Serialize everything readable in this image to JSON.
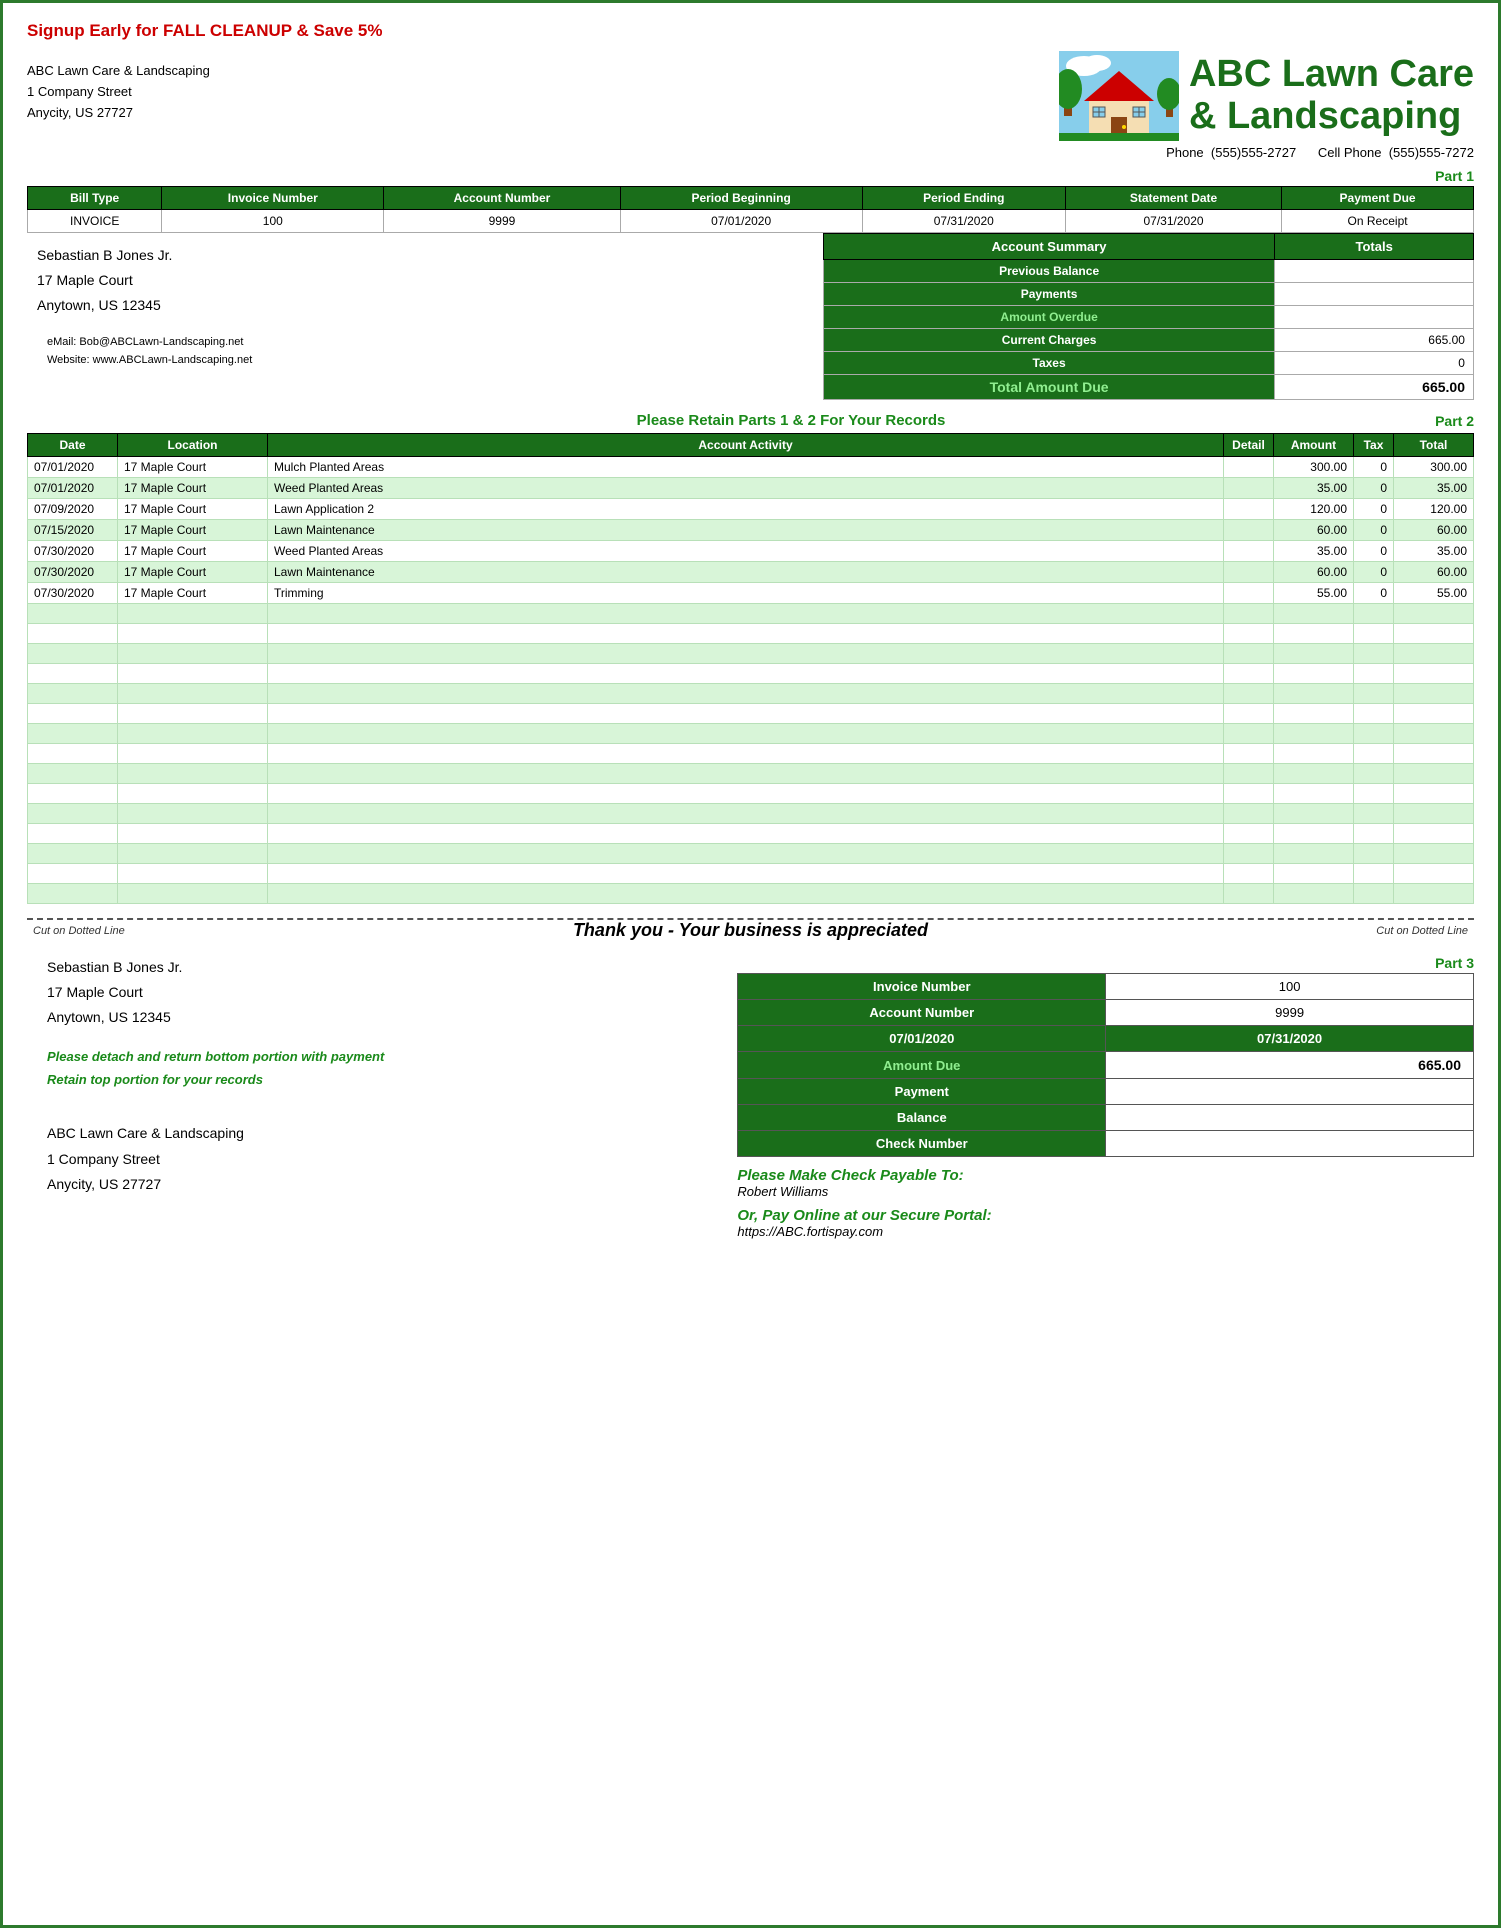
{
  "banner": {
    "text": "Signup Early for FALL CLEANUP & Save 5%"
  },
  "company": {
    "name": "ABC Lawn Care & Landscaping",
    "address1": "1 Company Street",
    "address2": "Anycity, US  27727",
    "phone_label": "Phone",
    "phone": "(555)555-2727",
    "cell_label": "Cell Phone",
    "cell": "(555)555-7272",
    "name_big_line1": "ABC Lawn Care",
    "name_big_line2": "& Landscaping"
  },
  "part1_label": "Part 1",
  "bill_headers": {
    "bill_type": "Bill Type",
    "invoice_number": "Invoice Number",
    "account_number": "Account Number",
    "period_beginning": "Period Beginning",
    "period_ending": "Period Ending",
    "statement_date": "Statement Date",
    "payment_due": "Payment Due"
  },
  "bill_row": {
    "bill_type": "INVOICE",
    "invoice_number": "100",
    "account_number": "9999",
    "period_beginning": "07/01/2020",
    "period_ending": "07/31/2020",
    "statement_date": "07/31/2020",
    "payment_due": "On Receipt"
  },
  "customer": {
    "name": "Sebastian B Jones Jr.",
    "address1": "17 Maple Court",
    "address2": "Anytown, US  12345",
    "email_label": "eMail:",
    "email": "Bob@ABCLawn-Landscaping.net",
    "website_label": "Website:",
    "website": "www.ABCLawn-Landscaping.net"
  },
  "account_summary": {
    "header1": "Account Summary",
    "header2": "Totals",
    "previous_balance": "Previous Balance",
    "previous_balance_value": "",
    "payments": "Payments",
    "payments_value": "",
    "amount_overdue": "Amount Overdue",
    "amount_overdue_value": "",
    "current_charges": "Current Charges",
    "current_charges_value": "665.00",
    "taxes": "Taxes",
    "taxes_value": "0",
    "total_due": "Total Amount Due",
    "total_due_value": "665.00"
  },
  "retain_text": "Please Retain Parts 1 & 2 For Your Records",
  "part2_label": "Part 2",
  "activity_headers": {
    "date": "Date",
    "location": "Location",
    "account_activity": "Account Activity",
    "detail": "Detail",
    "amount": "Amount",
    "tax": "Tax",
    "total": "Total"
  },
  "activity_rows": [
    {
      "date": "07/01/2020",
      "location": "17 Maple Court",
      "activity": "Mulch Planted Areas",
      "detail": "",
      "amount": "300.00",
      "tax": "0",
      "total": "300.00"
    },
    {
      "date": "07/01/2020",
      "location": "17 Maple Court",
      "activity": "Weed Planted Areas",
      "detail": "",
      "amount": "35.00",
      "tax": "0",
      "total": "35.00"
    },
    {
      "date": "07/09/2020",
      "location": "17 Maple Court",
      "activity": "Lawn Application 2",
      "detail": "",
      "amount": "120.00",
      "tax": "0",
      "total": "120.00"
    },
    {
      "date": "07/15/2020",
      "location": "17 Maple Court",
      "activity": "Lawn Maintenance",
      "detail": "",
      "amount": "60.00",
      "tax": "0",
      "total": "60.00"
    },
    {
      "date": "07/30/2020",
      "location": "17 Maple Court",
      "activity": "Weed Planted Areas",
      "detail": "",
      "amount": "35.00",
      "tax": "0",
      "total": "35.00"
    },
    {
      "date": "07/30/2020",
      "location": "17 Maple Court",
      "activity": "Lawn Maintenance",
      "detail": "",
      "amount": "60.00",
      "tax": "0",
      "total": "60.00"
    },
    {
      "date": "07/30/2020",
      "location": "17 Maple Court",
      "activity": "Trimming",
      "detail": "",
      "amount": "55.00",
      "tax": "0",
      "total": "55.00"
    }
  ],
  "cut_label_left": "Cut on Dotted Line",
  "cut_label_right": "Cut on Dotted Line",
  "thank_you": "Thank you - Your business is appreciated",
  "part3_label": "Part 3",
  "bottom_customer": {
    "name": "Sebastian B Jones Jr.",
    "address1": "17 Maple Court",
    "address2": "Anytown, US  12345"
  },
  "detach_note": {
    "line1": "Please detach and return bottom portion with payment",
    "line2": "Retain top portion for your records"
  },
  "return_address": {
    "name": "ABC Lawn Care & Landscaping",
    "address1": "1 Company Street",
    "address2": "Anycity, US   27727"
  },
  "payment_table": {
    "invoice_number_label": "Invoice Number",
    "invoice_number_value": "100",
    "account_number_label": "Account Number",
    "account_number_value": "9999",
    "period_start": "07/01/2020",
    "period_end": "07/31/2020",
    "amount_due_label": "Amount Due",
    "amount_due_value": "665.00",
    "payment_label": "Payment",
    "payment_value": "",
    "balance_label": "Balance",
    "balance_value": "",
    "check_number_label": "Check Number",
    "check_number_value": ""
  },
  "payable": {
    "header": "Please Make Check Payable To:",
    "name": "Robert Williams",
    "online_header": "Or, Pay Online at our Secure Portal:",
    "url": "https://ABC.fortispay.com"
  }
}
